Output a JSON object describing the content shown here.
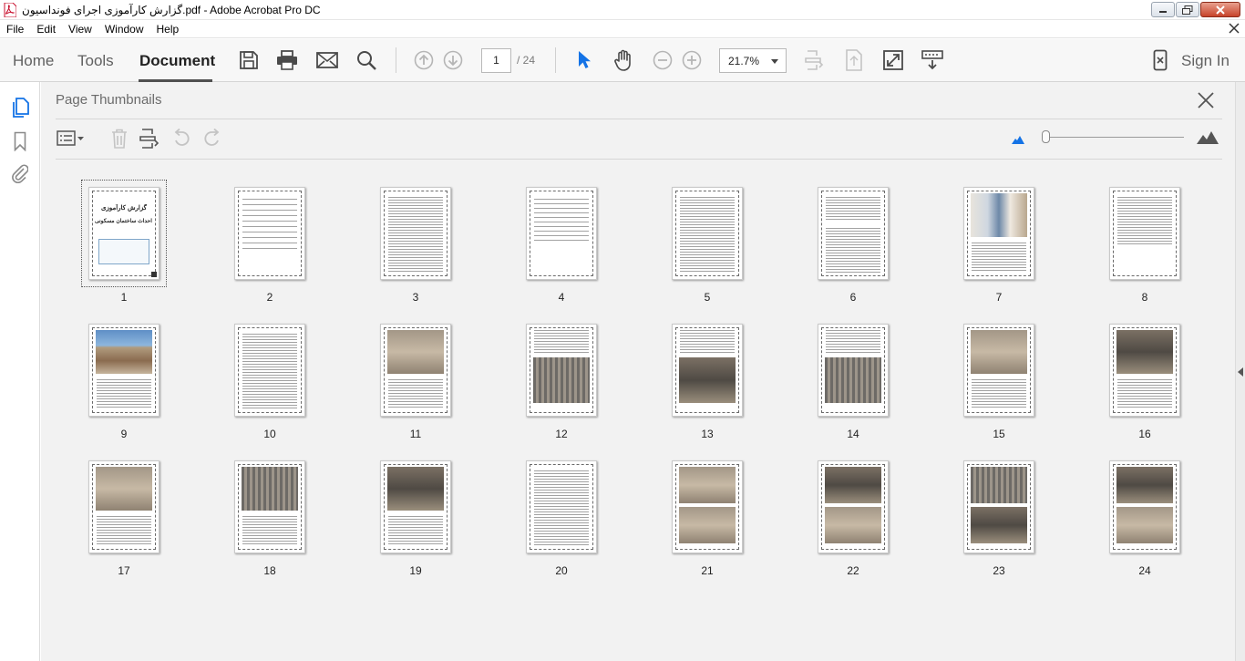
{
  "window": {
    "title": "گزارش کارآموزی اجرای فونداسیون.pdf - Adobe Acrobat Pro DC"
  },
  "menu": {
    "items": [
      "File",
      "Edit",
      "View",
      "Window",
      "Help"
    ]
  },
  "toolbar": {
    "tabs": [
      "Home",
      "Tools",
      "Document"
    ],
    "active_tab": "Document",
    "current_page": "1",
    "page_total": "/ 24",
    "zoom": "21.7%",
    "sign_in": "Sign In"
  },
  "panel": {
    "title": "Page Thumbnails"
  },
  "thumbnails": [
    {
      "num": "1",
      "selected": true
    },
    {
      "num": "2"
    },
    {
      "num": "3"
    },
    {
      "num": "4"
    },
    {
      "num": "5"
    },
    {
      "num": "6"
    },
    {
      "num": "7"
    },
    {
      "num": "8"
    },
    {
      "num": "9"
    },
    {
      "num": "10"
    },
    {
      "num": "11"
    },
    {
      "num": "12"
    },
    {
      "num": "13"
    },
    {
      "num": "14"
    },
    {
      "num": "15"
    },
    {
      "num": "16"
    },
    {
      "num": "17"
    },
    {
      "num": "18"
    },
    {
      "num": "19"
    },
    {
      "num": "20"
    },
    {
      "num": "21"
    },
    {
      "num": "22"
    },
    {
      "num": "23"
    },
    {
      "num": "24"
    }
  ],
  "cover_page": {
    "line1": "گزارش کارآموزی",
    "line2": "پروژه احداث ساختمان مسکونی"
  },
  "colors": {
    "accent_blue": "#1473e6",
    "toolbar_bg": "#f7f7f7",
    "panel_bg": "#f2f2f2"
  }
}
